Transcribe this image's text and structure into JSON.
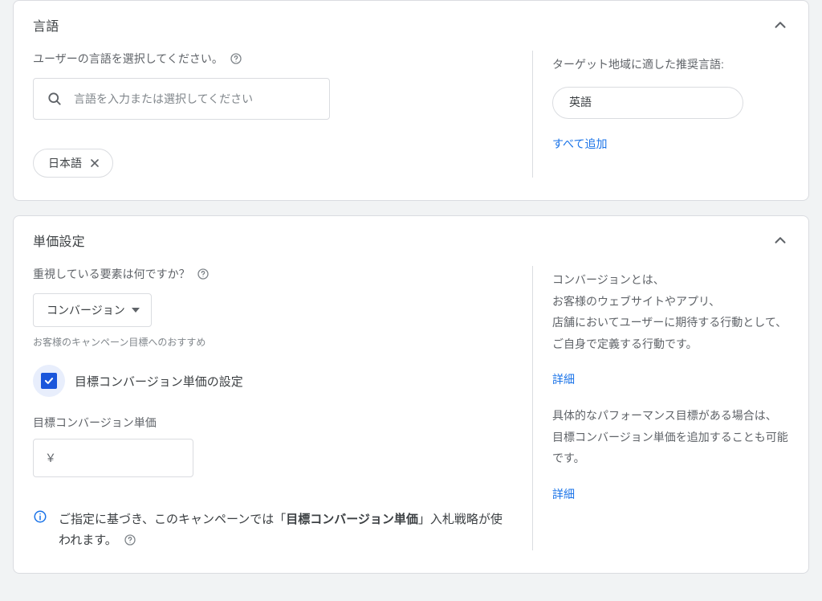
{
  "language": {
    "title": "言語",
    "prompt": "ユーザーの言語を選択してください。",
    "search_placeholder": "言語を入力または選択してください",
    "selected_chip": "日本語",
    "right_title": "ターゲット地域に適した推奨言語:",
    "suggested_pill": "英語",
    "add_all": "すべて追加"
  },
  "bidding": {
    "title": "単価設定",
    "focus_label": "重視している要素は何ですか？",
    "focus_value": "コンバージョン",
    "recommendation_helper": "お客様のキャンペーン目標へのおすすめ",
    "checkbox_label": "目標コンバージョン単価の設定",
    "target_cpa_label": "目標コンバージョン単価",
    "currency_symbol": "￥",
    "info_prefix": "ご指定に基づき、このキャンペーンでは「",
    "info_bold": "目標コンバージョン単価",
    "info_suffix": "」入札戦略が使われます。",
    "right": {
      "p1": "コンバージョンとは、\nお客様のウェブサイトやアプリ、\n店舗においてユーザーに期待する行動として、\nご自身で定義する行動です。",
      "p2": "具体的なパフォーマンス目標がある場合は、\n目標コンバージョン単価を追加することも可能です。",
      "link": "詳細"
    }
  }
}
